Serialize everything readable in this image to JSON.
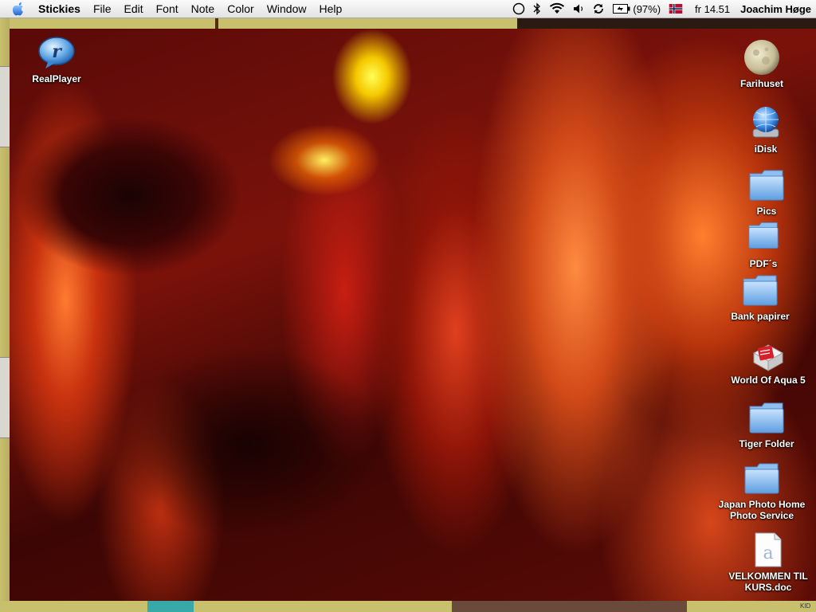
{
  "menubar": {
    "app_name": "Stickies",
    "items": [
      "File",
      "Edit",
      "Font",
      "Note",
      "Color",
      "Window",
      "Help"
    ],
    "battery": "(97%)",
    "clock": "fr 14.51",
    "user": "Joachim Høge"
  },
  "desktop_icons": {
    "realplayer": "RealPlayer",
    "farihuset": "Farihuset",
    "idisk": "iDisk",
    "pics": "Pics",
    "pdfs": "PDF´s",
    "bank": "Bank papirer",
    "world_of_aqua": "World Of Aqua 5",
    "tiger": "Tiger Folder",
    "japan_line1": "Japan Photo Home",
    "japan_line2": "Photo Service",
    "velkommen_line1": "VELKOMMEN TIL",
    "velkommen_line2": "KURS.doc"
  },
  "edge_label": "KID",
  "colors": {
    "menubar_bg": "#f0f0f0",
    "stickies_yellow": "#c9c06e",
    "folder_blue": "#6aa8e8"
  }
}
